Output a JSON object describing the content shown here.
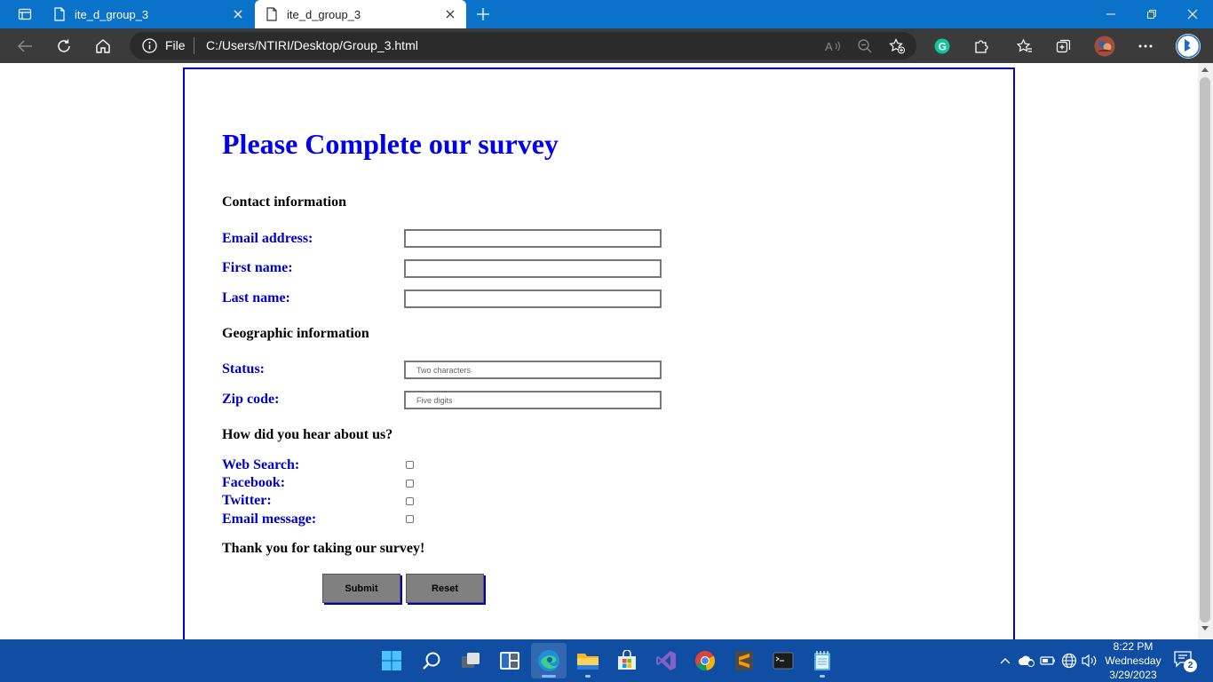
{
  "browser": {
    "tabs": [
      {
        "title": "ite_d_group_3",
        "active": false
      },
      {
        "title": "ite_d_group_3",
        "active": true
      }
    ],
    "address": {
      "scheme_label": "File",
      "url": "C:/Users/NTIRI/Desktop/Group_3.html"
    }
  },
  "survey": {
    "heading": "Please Complete our survey",
    "contact_section": "Contact information",
    "email_label": "Email address:",
    "first_name_label": "First name:",
    "last_name_label": "Last name:",
    "geo_section": "Geographic information",
    "status_label": "Status:",
    "status_placeholder": "Two characters",
    "zip_label": "Zip code:",
    "zip_placeholder": "Five digits",
    "hear_section": "How did you hear about us?",
    "web_search_label": "Web Search:",
    "facebook_label": "Facebook:",
    "twitter_label": "Twitter:",
    "email_message_label": "Email message:",
    "thanks": "Thank you for taking our survey!",
    "submit_label": "Submit",
    "reset_label": "Reset"
  },
  "taskbar": {
    "time": "8:22 PM",
    "day": "Wednesday",
    "date": "3/29/2023",
    "notification_count": "2"
  },
  "colors": {
    "titlebar": "#0a72c8",
    "heading_blue": "#0000ee",
    "label_blue": "#0000cd",
    "taskbar": "#0f4ea3"
  }
}
